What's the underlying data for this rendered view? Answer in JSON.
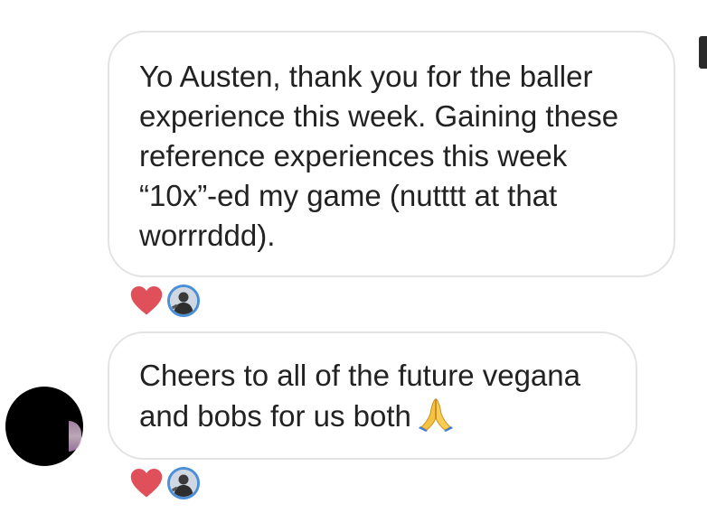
{
  "conversation": {
    "messages": [
      {
        "lines": [
          "Yo Austen, thank you for the baller",
          "experience this week. Gaining these",
          "reference experiences this week",
          "“10x”-ed my game (nutttt at that",
          "worrrddd)."
        ],
        "reactions": [
          {
            "icon": "heart-icon",
            "color": "#e0505a"
          },
          {
            "icon": "reactor-avatar",
            "ring_color": "#4a8fd8"
          }
        ]
      },
      {
        "lines": [
          "Cheers to all of the future vegana",
          "and bobs for us both"
        ],
        "trailing_icon": "folded-hands-emoji",
        "reactions": [
          {
            "icon": "heart-icon",
            "color": "#e0505a"
          },
          {
            "icon": "reactor-avatar",
            "ring_color": "#4a8fd8"
          }
        ]
      }
    ]
  },
  "colors": {
    "bubble_border": "#e3e3e3",
    "text": "#222222",
    "heart": "#e0505a",
    "avatar_ring": "#4a8fd8"
  }
}
